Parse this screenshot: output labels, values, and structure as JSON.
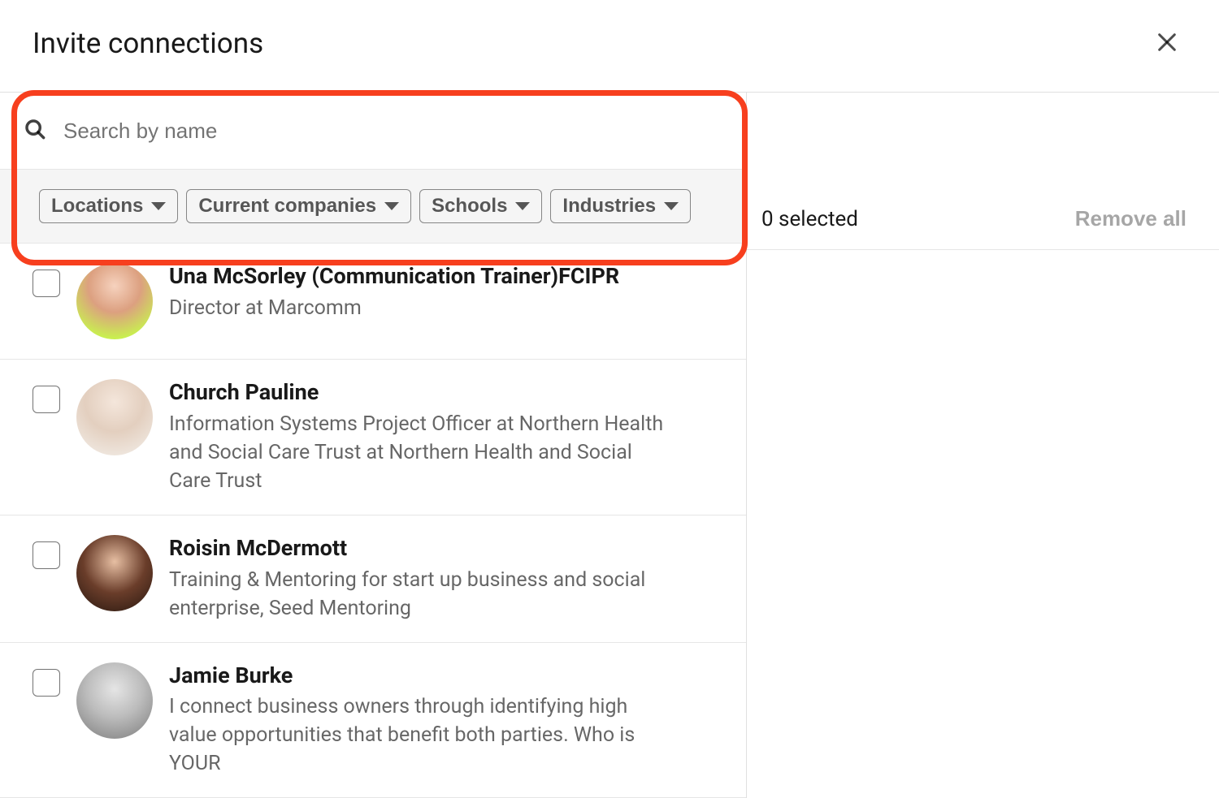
{
  "modal": {
    "title": "Invite connections"
  },
  "search": {
    "placeholder": "Search by name"
  },
  "filters": [
    {
      "label": "Locations"
    },
    {
      "label": "Current companies"
    },
    {
      "label": "Schools"
    },
    {
      "label": "Industries"
    }
  ],
  "connections": [
    {
      "name": "Una McSorley (Communication Trainer)FCIPR",
      "subtitle": "Director at Marcomm"
    },
    {
      "name": "Church Pauline",
      "subtitle": "Information Systems Project Officer at Northern Health and Social Care Trust at Northern Health and Social Care Trust"
    },
    {
      "name": "Roisin McDermott",
      "subtitle": "Training & Mentoring for start up business and social enterprise, Seed Mentoring"
    },
    {
      "name": "Jamie Burke",
      "subtitle": "I connect business owners through identifying high value opportunities that benefit both parties. Who is YOUR"
    }
  ],
  "rightPanel": {
    "selectedText": "0 selected",
    "removeAll": "Remove all"
  }
}
